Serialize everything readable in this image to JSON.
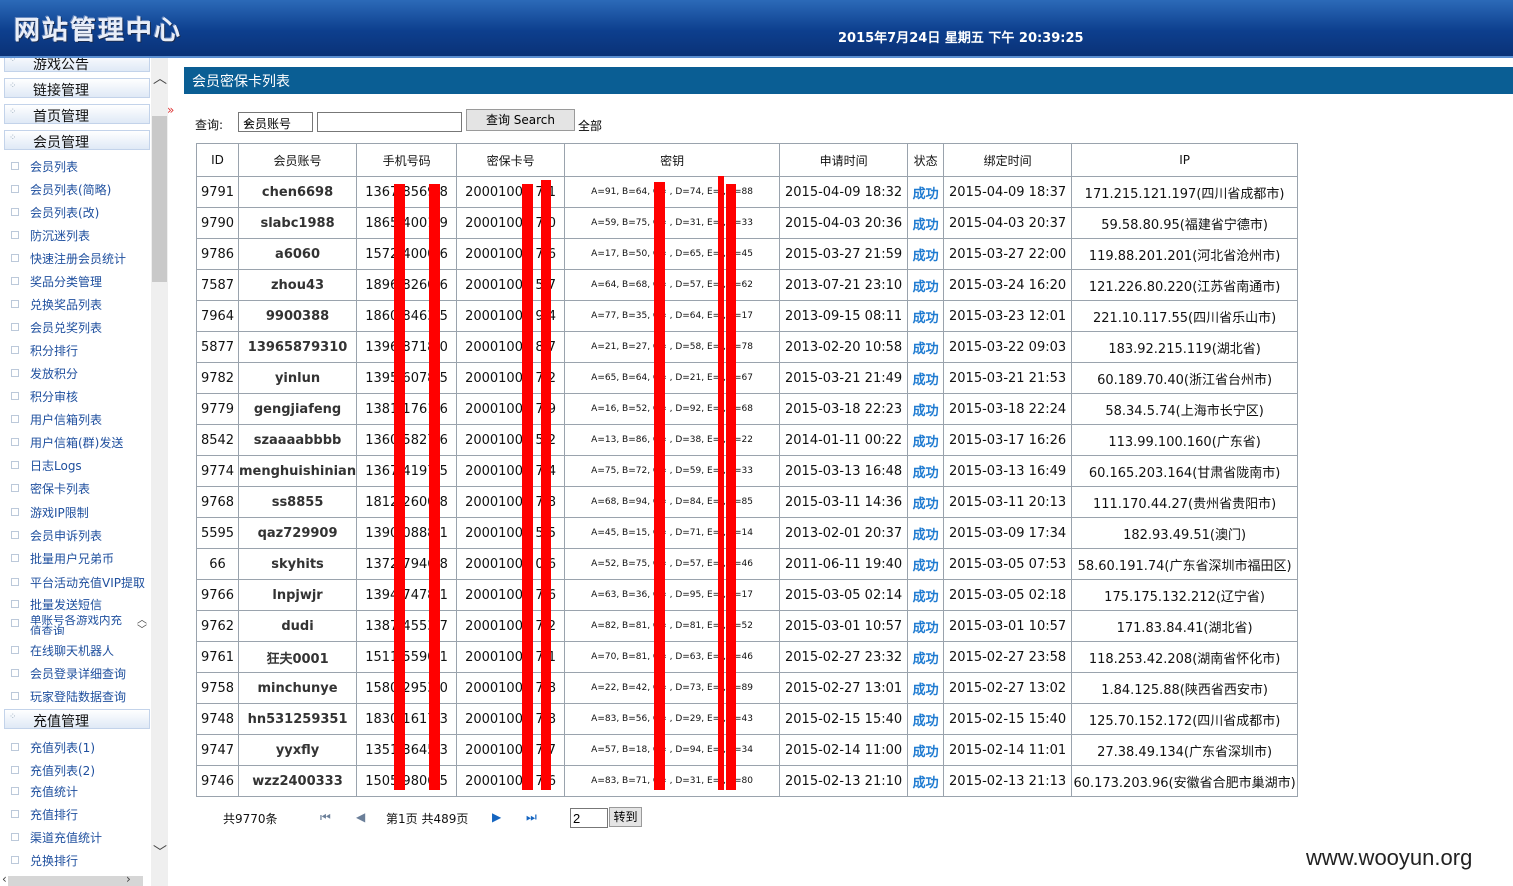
{
  "header": {
    "logo": "网站管理中心",
    "datetime": "2015年7月24日 星期五 下午 20:39:25"
  },
  "sidebar": {
    "sections": [
      "游戏公告",
      "链接管理",
      "首页管理",
      "会员管理",
      "充值管理"
    ],
    "member_items": [
      "会员列表",
      "会员列表(简略)",
      "会员列表(改)",
      "防沉迷列表",
      "快速注册会员统计",
      "奖品分类管理",
      "兑换奖品列表",
      "会员兑奖列表",
      "积分排行",
      "发放积分",
      "积分审核",
      "用户信箱列表",
      "用户信箱(群)发送",
      "日志Logs",
      "密保卡列表",
      "游戏IP限制",
      "会员申诉列表",
      "批量用户兄弟币",
      "平台活动充值VIP提取",
      "批量发送短信",
      "单账号各游戏内充值查询",
      "在线聊天机器人",
      "会员登录详细查询",
      "玩家登陆数据查询"
    ],
    "recharge_items": [
      "充值列表(1)",
      "充值列表(2)",
      "充值统计",
      "充值排行",
      "渠道充值统计",
      "兑换排行"
    ],
    "collapse_glyph": "»"
  },
  "page": {
    "title": "会员密保卡列表"
  },
  "search": {
    "label": "查询:",
    "select_value": "会员账号",
    "button": "查询 Search",
    "all_link": "全部"
  },
  "table": {
    "headers": [
      "ID",
      "会员账号",
      "手机号码",
      "密保卡号",
      "密钥",
      "申请时间",
      "状态",
      "绑定时间",
      "IP"
    ],
    "rows": [
      [
        "9791",
        "chen6698",
        "1367  8569  8",
        "20001001  7  1",
        "A=91, B=64, C=  , D=74, E=  , F=88",
        "2015-04-09 18:32",
        "成功",
        "2015-04-09 18:37",
        "171.215.121.197(四川省成都市)"
      ],
      [
        "9790",
        "slabc1988",
        "1865  4001  9",
        "20001001  7  0",
        "A=59, B=75, C=  , D=31, E=  , F=33",
        "2015-04-03 20:36",
        "成功",
        "2015-04-03 20:37",
        "59.58.80.95(福建省宁德市)"
      ],
      [
        "9786",
        "a6060",
        "1572  4000  6",
        "20001001  7  6",
        "A=17, B=50, C=  , D=65, E=  , F=45",
        "2015-03-27 21:59",
        "成功",
        "2015-03-27 22:00",
        "119.88.201.201(河北省沧州市)"
      ],
      [
        "7587",
        "zhou43",
        "1896  8260  6",
        "20001000  5  7",
        "A=64, B=68, C=  , D=57, E=  , F=62",
        "2013-07-21 23:10",
        "成功",
        "2015-03-24 16:20",
        "121.226.80.220(江苏省南通市)"
      ],
      [
        "7964",
        "9900388",
        "1860  8463  5",
        "20001000  9  4",
        "A=77, B=35, C=  , D=64, E=  , F=17",
        "2013-09-15 08:11",
        "成功",
        "2015-03-23 12:01",
        "221.10.117.55(四川省乐山市)"
      ],
      [
        "5877",
        "13965879310",
        "1396  8718  0",
        "20001000  8  7",
        "A=21, B=27, C=  , D=58, E=  , F=78",
        "2013-02-20 10:58",
        "成功",
        "2015-03-22 09:03",
        "183.92.215.119(湖北省)"
      ],
      [
        "9782",
        "yinlun",
        "1395  6078  5",
        "20001001  7  2",
        "A=65, B=64, C=  , D=21, E=  , F=67",
        "2015-03-21 21:49",
        "成功",
        "2015-03-21 21:53",
        "60.189.70.40(浙江省台州市)"
      ],
      [
        "9779",
        "gengjiafeng",
        "1381  1761  6",
        "20001001  7  9",
        "A=16, B=52, C=  , D=92, E=  , F=68",
        "2015-03-18 22:23",
        "成功",
        "2015-03-18 22:24",
        "58.34.5.74(上海市长宁区)"
      ],
      [
        "8542",
        "szaaaabbbb",
        "1360  5827  6",
        "20001000  5  2",
        "A=13, B=86, C=  , D=38, E=  , F=22",
        "2014-01-11 00:22",
        "成功",
        "2015-03-17 16:26",
        "113.99.100.160(广东省)"
      ],
      [
        "9774",
        "menghuishinian",
        "1367  4197  5",
        "20001001  7  4",
        "A=75, B=72, C=  , D=59, E=  , F=33",
        "2015-03-13 16:48",
        "成功",
        "2015-03-13 16:49",
        "60.165.203.164(甘肃省陇南市)"
      ],
      [
        "9768",
        "ss8855",
        "1812  2600  8",
        "20001001  7  8",
        "A=68, B=94, C=  , D=84, E=  , F=85",
        "2015-03-11 14:36",
        "成功",
        "2015-03-11 20:13",
        "111.170.44.27(贵州省贵阳市)"
      ],
      [
        "5595",
        "qaz729909",
        "1390  0888  1",
        "20001000  5  5",
        "A=45, B=15, C=  , D=71, E=  , F=14",
        "2013-02-01 20:37",
        "成功",
        "2015-03-09 17:34",
        "182.93.49.51(澳门)"
      ],
      [
        "66",
        "skyhits",
        "1372  7946  8",
        "20001000  0  6",
        "A=52, B=75, C=  , D=57, E=  , F=46",
        "2011-06-11 19:40",
        "成功",
        "2015-03-05 07:53",
        "58.60.191.74(广东省深圳市福田区)"
      ],
      [
        "9766",
        "lnpjwjr",
        "1394  7478  1",
        "20001001  7  6",
        "A=63, B=36, C=  , D=95, E=  , F=17",
        "2015-03-05 02:14",
        "成功",
        "2015-03-05 02:18",
        "175.175.132.212(辽宁省)"
      ],
      [
        "9762",
        "dudi",
        "1387  4553  7",
        "20001001  7  2",
        "A=82, B=81, C=  , D=81, E=  , F=52",
        "2015-03-01 10:57",
        "成功",
        "2015-03-01 10:57",
        "171.83.84.41(湖北省)"
      ],
      [
        "9761",
        "狂夫0001",
        "1511  5590  1",
        "20001001  7  1",
        "A=70, B=81, C=  , D=63, E=  , F=46",
        "2015-02-27 23:32",
        "成功",
        "2015-02-27 23:58",
        "118.253.42.208(湖南省怀化市)"
      ],
      [
        "9758",
        "minchunye",
        "1580  2953  0",
        "20001001  7  8",
        "A=22, B=42, C=  , D=73, E=  , F=89",
        "2015-02-27 13:01",
        "成功",
        "2015-02-27 13:02",
        "1.84.125.88(陕西省西安市)"
      ],
      [
        "9748",
        "hn531259351",
        "1830  1617  3",
        "20001001  7  8",
        "A=83, B=56, C=  , D=29, E=  , F=43",
        "2015-02-15 15:40",
        "成功",
        "2015-02-15 15:40",
        "125.70.152.172(四川省成都市)"
      ],
      [
        "9747",
        "yyxfly",
        "1351  3645  3",
        "20001001  7  7",
        "A=57, B=18, C=  , D=94, E=  , F=34",
        "2015-02-14 11:00",
        "成功",
        "2015-02-14 11:01",
        "27.38.49.134(广东省深圳市)"
      ],
      [
        "9746",
        "wzz2400333",
        "1505  9806  5",
        "20001001  7  6",
        "A=83, B=71, C=  , D=31, E=  , F=80",
        "2015-02-13 21:10",
        "成功",
        "2015-02-13 21:13",
        "60.173.203.96(安徽省合肥市巢湖市)"
      ]
    ]
  },
  "pager": {
    "total": "共9770条",
    "page_info": "第1页 共489页",
    "goto_value": "2",
    "goto_button": "转到"
  },
  "watermark": "www.wooyun.org"
}
